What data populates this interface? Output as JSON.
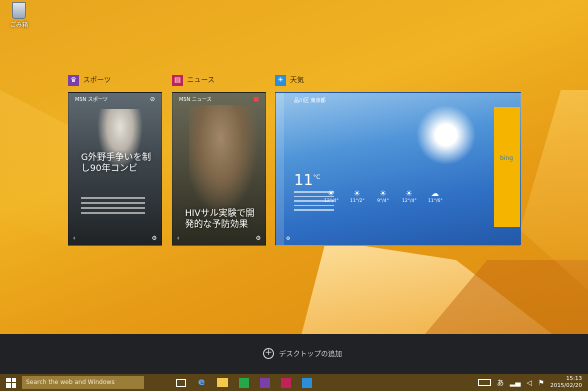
{
  "desktop": {
    "recycle_bin_label": "ごみ箱"
  },
  "apps": [
    {
      "title": "スポーツ",
      "brand": "MSN スポーツ",
      "headline": "G外野手争いを制し90年コンビ",
      "icon": "trophy-icon",
      "color": "#7a3fa8"
    },
    {
      "title": "ニュース",
      "brand": "MSN ニュース",
      "headline": "HIVサル実験で開発的な予防効果",
      "icon": "news-icon",
      "color": "#c0235a"
    },
    {
      "title": "天気",
      "location": "品川区 東京都",
      "temperature": "11",
      "temp_unit": "°C",
      "icon": "sun-icon",
      "color": "#2a8fd8",
      "forecast": [
        {
          "temp": "12°/4°",
          "icon": "☀"
        },
        {
          "temp": "11°/2°",
          "icon": "☀"
        },
        {
          "temp": "9°/4°",
          "icon": "☀"
        },
        {
          "temp": "12°/4°",
          "icon": "☀"
        },
        {
          "temp": "11°/6°",
          "icon": "☁"
        }
      ],
      "side_brand": "bing"
    }
  ],
  "taskview": {
    "add_desktop_label": "デスクトップの追加"
  },
  "taskbar": {
    "search_placeholder": "Search the web and Windows",
    "ime_label": "あ",
    "clock_time": "15:13",
    "clock_date": "2015/02/20"
  }
}
